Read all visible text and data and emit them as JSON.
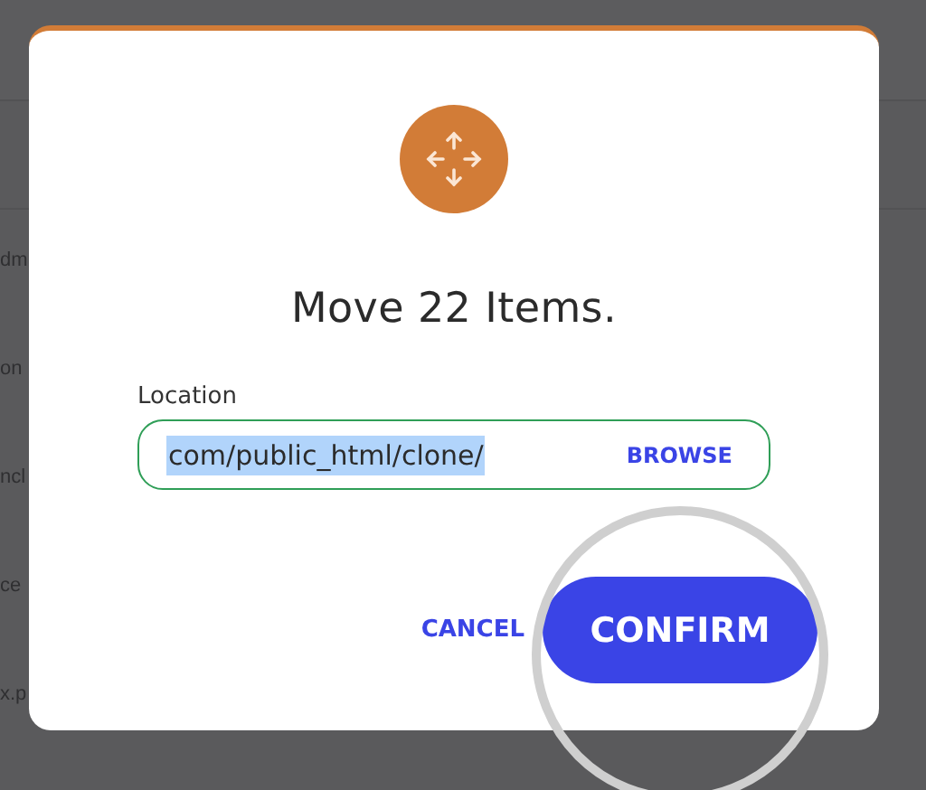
{
  "background_list": [
    {
      "label": "dm"
    },
    {
      "label": "on"
    },
    {
      "label": "ncl"
    },
    {
      "label": "ce"
    },
    {
      "label": "x.p"
    }
  ],
  "dialog": {
    "title": "Move 22 Items.",
    "field": {
      "label": "Location",
      "value": "com/public_html/clone/",
      "value_selected": true,
      "action": "BROWSE"
    },
    "buttons": [
      {
        "label": "CANCEL",
        "kind": "text"
      },
      {
        "label": "CONFIRM",
        "kind": "primary",
        "magnified": true
      }
    ]
  }
}
